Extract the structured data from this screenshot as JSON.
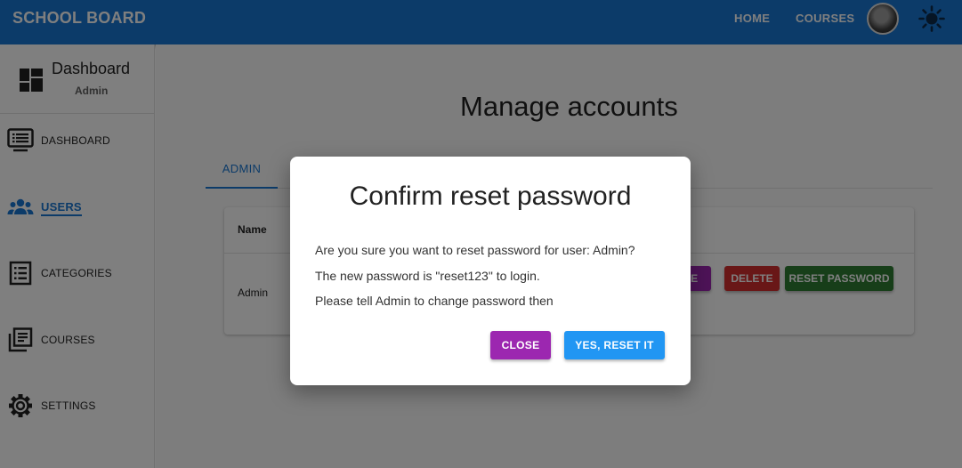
{
  "header": {
    "brand": "SCHOOL BOARD",
    "nav": [
      "HOME",
      "COURSES"
    ],
    "avatar_icon": "user-avatar",
    "theme_icon": "sun-icon",
    "color": "#1976d2"
  },
  "sidebar": {
    "title": "Dashboard",
    "subtitle": "Admin",
    "items": [
      {
        "label": "DASHBOARD",
        "icon": "monitor-list-icon"
      },
      {
        "label": "USERS",
        "icon": "people-icon",
        "active": true
      },
      {
        "label": "CATEGORIES",
        "icon": "list-icon"
      },
      {
        "label": "COURSES",
        "icon": "library-icon"
      },
      {
        "label": "SETTINGS",
        "icon": "gear-icon"
      }
    ]
  },
  "main": {
    "title": "Manage accounts",
    "tabs": [
      "ADMIN"
    ],
    "table": {
      "columns": [
        "Name"
      ],
      "rows": [
        {
          "name": "Admin",
          "actions": [
            "LE",
            "DELETE",
            "RESET PASSWORD"
          ]
        }
      ]
    }
  },
  "dialog": {
    "title": "Confirm reset password",
    "lines": [
      "Are you sure you want to reset password for user: Admin?",
      "The new password is \"reset123\" to login.",
      "Please tell Admin to change password then"
    ],
    "close_label": "CLOSE",
    "confirm_label": "YES, RESET IT"
  }
}
